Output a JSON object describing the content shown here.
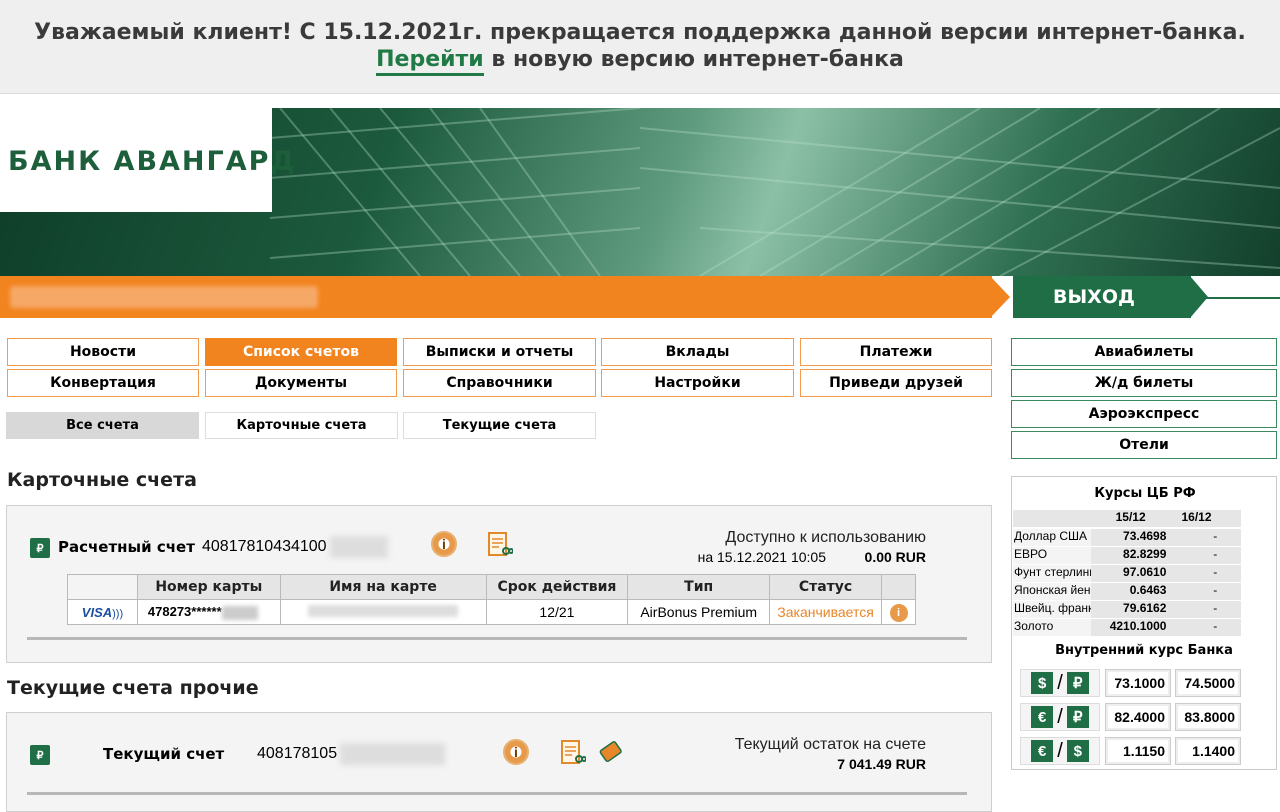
{
  "banner": {
    "line1": "Уважаемый клиент! С 15.12.2021г. прекращается поддержка данной версии интернет-банка.",
    "link": "Перейти",
    "line2": " в новую версию интернет-банка"
  },
  "brand": {
    "logo": "БАНК АВАНГАРД"
  },
  "header": {
    "exit_label": "ВЫХОД"
  },
  "nav": {
    "row1": [
      "Новости",
      "Список счетов",
      "Выписки и отчеты",
      "Вклады",
      "Платежи"
    ],
    "row2": [
      "Конвертация",
      "Документы",
      "Справочники",
      "Настройки",
      "Приведи друзей"
    ],
    "active": "Список счетов"
  },
  "side_links": [
    "Авиабилеты",
    "Ж/д билеты",
    "Аэроэкспресс",
    "Отели"
  ],
  "sub_tabs": [
    "Все счета",
    "Карточные счета",
    "Текущие счета"
  ],
  "card_section": {
    "title": "Карточные счета",
    "account_label": "Расчетный счет",
    "account_number": "40817810434100",
    "available_label": "Доступно к использованию",
    "available_date": "на 15.12.2021 10:05",
    "available_amount": "0.00 RUR",
    "table_headers": [
      "Номер карты",
      "Имя на карте",
      "Срок действия",
      "Тип",
      "Статус"
    ],
    "card": {
      "brand": "VISA",
      "number": "478273******",
      "expiry": "12/21",
      "type": "AirBonus Premium",
      "status": "Заканчивается"
    }
  },
  "current_section": {
    "title": "Текущие счета прочие",
    "account_label": "Текущий счет",
    "account_number": "408178105",
    "balance_label": "Текущий остаток на счете",
    "balance_amount": "7 041.49 RUR"
  },
  "rates": {
    "title": "Курсы ЦБ РФ",
    "col1": "15/12",
    "col2": "16/12",
    "rows": [
      {
        "name": "Доллар США",
        "v1": "73.4698",
        "v2": "-"
      },
      {
        "name": "ЕВРО",
        "v1": "82.8299",
        "v2": "-"
      },
      {
        "name": "Фунт стерлинг.",
        "v1": "97.0610",
        "v2": "-"
      },
      {
        "name": "Японская йена",
        "v1": "0.6463",
        "v2": "-"
      },
      {
        "name": "Швейц. франк",
        "v1": "79.6162",
        "v2": "-"
      },
      {
        "name": "Золото",
        "v1": "4210.1000",
        "v2": "-"
      }
    ],
    "internal_title": "Внутренний курс Банка",
    "internal": [
      {
        "pair": [
          "$",
          "₽"
        ],
        "buy": "73.1000",
        "sell": "74.5000"
      },
      {
        "pair": [
          "€",
          "₽"
        ],
        "buy": "82.4000",
        "sell": "83.8000"
      },
      {
        "pair": [
          "€",
          "$"
        ],
        "buy": "1.1150",
        "sell": "1.1400"
      }
    ]
  },
  "colors": {
    "brand_green": "#1f6e46",
    "accent_orange": "#f2841f"
  }
}
